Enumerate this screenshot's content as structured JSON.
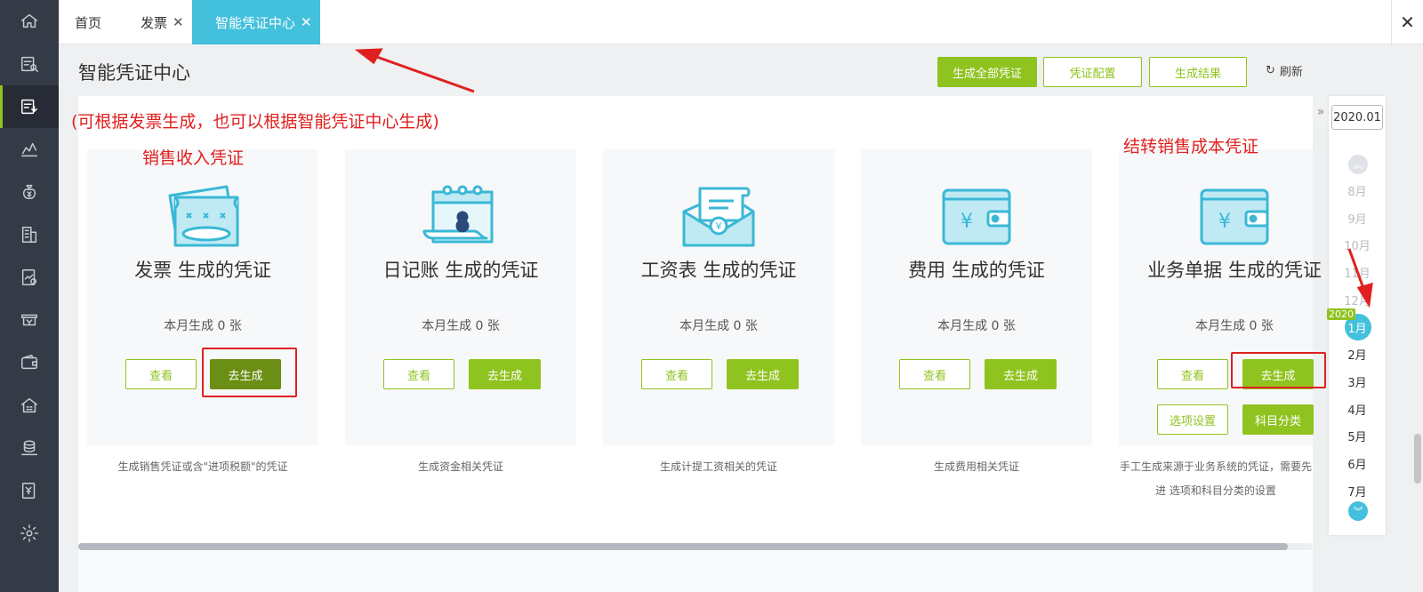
{
  "sidebar": {
    "items": [
      {
        "icon": "home-icon"
      },
      {
        "icon": "search-document-icon"
      },
      {
        "icon": "voucher-icon",
        "active": true
      },
      {
        "icon": "chart-icon"
      },
      {
        "icon": "money-bag-icon"
      },
      {
        "icon": "ledger-icon"
      },
      {
        "icon": "report-icon"
      },
      {
        "icon": "tax-icon"
      },
      {
        "icon": "wallet-icon"
      },
      {
        "icon": "building-icon"
      },
      {
        "icon": "coins-icon"
      },
      {
        "icon": "invoice-icon"
      },
      {
        "icon": "settings-icon"
      }
    ]
  },
  "tabs": [
    {
      "label": "首页",
      "closable": false
    },
    {
      "label": "发票",
      "closable": true
    },
    {
      "label": "智能凭证中心",
      "closable": true,
      "active": true
    }
  ],
  "header": {
    "title": "智能凭证中心",
    "btn_generate_all": "生成全部凭证",
    "btn_config": "凭证配置",
    "btn_result": "生成结果",
    "refresh": "刷新"
  },
  "annotations": {
    "note_top": "(可根据发票生成，也可以根据智能凭证中心生成)",
    "note_sales": "销售收入凭证",
    "note_cost": "结转销售成本凭证"
  },
  "cards": [
    {
      "title": "发票 生成的凭证",
      "count": "本月生成 0 张",
      "view": "查看",
      "go": "去生成",
      "desc": "生成销售凭证或含\"进项税额\"的凭证",
      "icon": "invoice-ticket-icon"
    },
    {
      "title": "日记账 生成的凭证",
      "count": "本月生成 0 张",
      "view": "查看",
      "go": "去生成",
      "desc": "生成资金相关凭证",
      "icon": "journal-calendar-icon"
    },
    {
      "title": "工资表 生成的凭证",
      "count": "本月生成 0 张",
      "view": "查看",
      "go": "去生成",
      "desc": "生成计提工资相关的凭证",
      "icon": "salary-envelope-icon"
    },
    {
      "title": "费用 生成的凭证",
      "count": "本月生成  0 张",
      "view": "查看",
      "go": "去生成",
      "desc": "生成费用相关凭证",
      "icon": "expense-wallet-icon"
    },
    {
      "title": "业务单据 生成的凭证",
      "count": "本月生成  0 张",
      "view": "查看",
      "go": "去生成",
      "opt": "选项设置",
      "subject": "科目分类",
      "desc": "手工生成来源于业务系统的凭证，需要先进 选项和科目分类的设置",
      "icon": "business-wallet-icon"
    }
  ],
  "timeline": {
    "period_input": "2020.01",
    "year_badge": "2020",
    "months": [
      "8月",
      "9月",
      "10月",
      "11月",
      "12月",
      "1月",
      "2月",
      "3月",
      "4月",
      "5月",
      "6月",
      "7月"
    ],
    "active_month": "1月"
  },
  "colors": {
    "accent": "#8fc31f",
    "tab_active": "#42c0dc",
    "annotation": "#e02020",
    "sidebar": "#353a47"
  }
}
